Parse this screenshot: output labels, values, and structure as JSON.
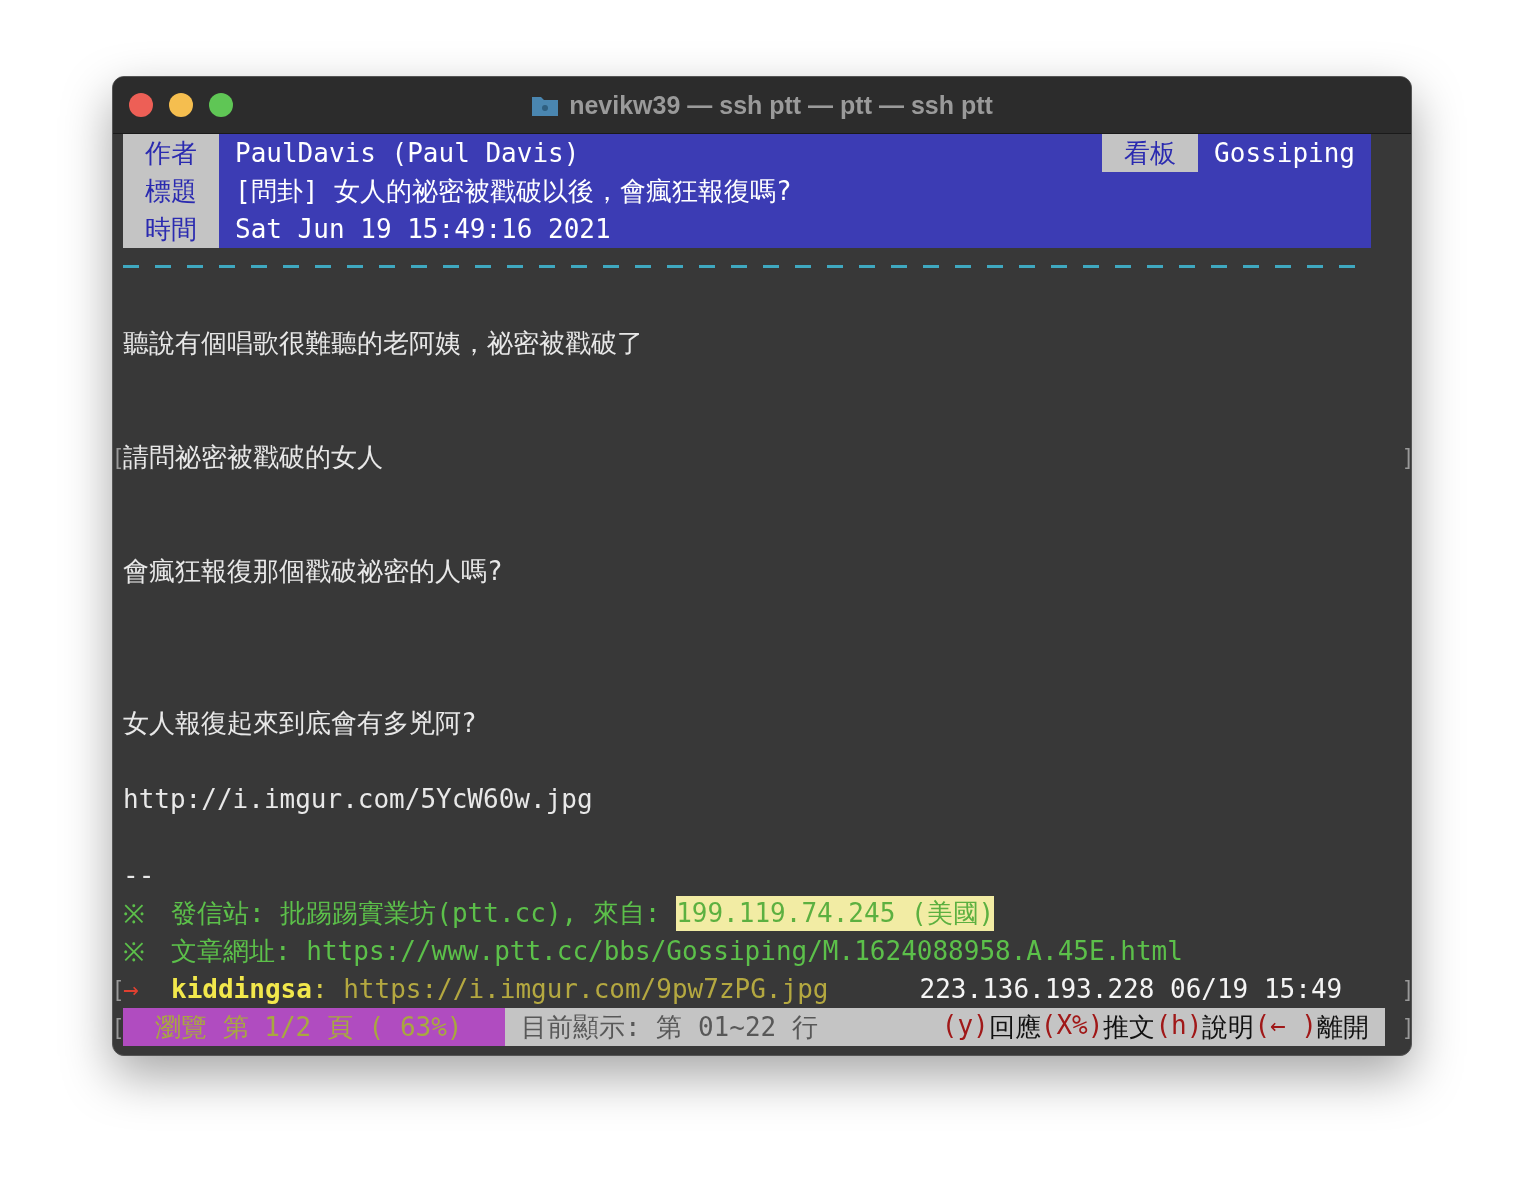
{
  "window": {
    "title": "nevikw39 — ssh ptt — ptt — ssh ptt"
  },
  "header": {
    "fields": [
      {
        "label": "作者",
        "value": "PaulDavis (Paul Davis)"
      },
      {
        "label": "標題",
        "value": "[問卦] 女人的祕密被戳破以後，會瘋狂報復嗎?"
      },
      {
        "label": "時間",
        "value": "Sat Jun 19 15:49:16 2021"
      }
    ],
    "board_label": "看板",
    "board": "Gossiping"
  },
  "body": [
    {
      "text": "聽說有個唱歌很難聽的老阿姨，祕密被戳破了"
    },
    {
      "text": "請問祕密被戳破的女人",
      "left_mark": "[",
      "right_mark": "]"
    },
    {
      "text": "會瘋狂報復那個戳破祕密的人嗎?"
    },
    {
      "text": "女人報復起來到底會有多兇阿?"
    },
    {
      "text": "http://i.imgur.com/5YcW60w.jpg"
    },
    {
      "text": "--"
    }
  ],
  "signature": [
    {
      "mark": "※",
      "text": "發信站: 批踢踢實業坊(ptt.cc), 來自: ",
      "highlight": "199.119.74.245 (美國)"
    },
    {
      "mark": "※",
      "text": "文章網址: https://www.ptt.cc/bbs/Gossiping/M.1624088958.A.45E.html"
    }
  ],
  "push": {
    "left_mark": "[",
    "arrow": "→",
    "user": "kiddingsa",
    "sep": ":",
    "content": " https://i.imgur.com/9pw7zPG.jpg",
    "meta": "223.136.193.228 06/19 15:49",
    "right_mark": "]"
  },
  "status_bar": {
    "left_mark": "[",
    "page": "瀏覽 第 1/2 頁 ( 63%)",
    "range": "目前顯示: 第 01~22 行",
    "keys": [
      {
        "key": "(y)",
        "action": "回應"
      },
      {
        "key": "(X%)",
        "action": "推文"
      },
      {
        "key": "(h)",
        "action": "說明"
      },
      {
        "key": "(← )",
        "action": "離開"
      }
    ],
    "right_mark": "]"
  }
}
